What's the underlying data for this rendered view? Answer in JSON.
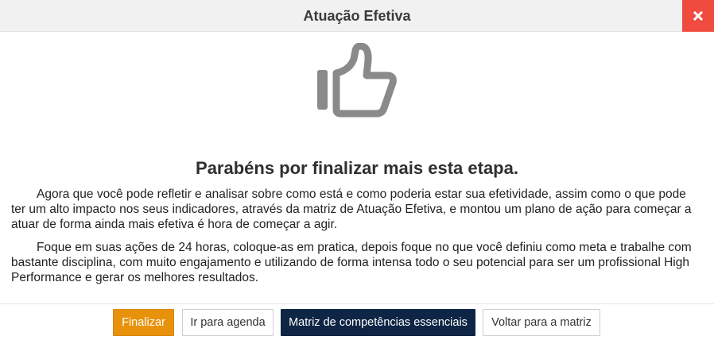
{
  "modal": {
    "title": "Atuação Efetiva",
    "close_icon": "close-icon"
  },
  "hero": {
    "icon": "thumbs-up-icon",
    "heading": "Parabéns por finalizar mais esta etapa."
  },
  "paragraphs": [
    "Agora que você pode refletir e analisar sobre como está e como poderia estar sua efetividade, assim como o que pode ter um alto impacto nos seus indicadores, através da matriz de Atuação Efetiva, e montou um plano de ação para começar a atuar de forma ainda mais efetiva é hora de começar a agir.",
    "Foque em suas ações de 24 horas, coloque-as em pratica, depois foque no que você definiu como meta e trabalhe com bastante disciplina, com muito engajamento e utilizando de forma intensa todo o seu potencial para ser um profissional High Performance e gerar os melhores resultados."
  ],
  "footer": {
    "finalizar_label": "Finalizar",
    "agenda_label": "Ir para agenda",
    "matriz_label": "Matriz de competências essenciais",
    "voltar_label": "Voltar para a matriz"
  },
  "colors": {
    "close_bg": "#ef4b3f",
    "finalizar_bg": "#e8920c",
    "matriz_bg": "#0f2545",
    "icon_gray": "#8a8a8a"
  }
}
